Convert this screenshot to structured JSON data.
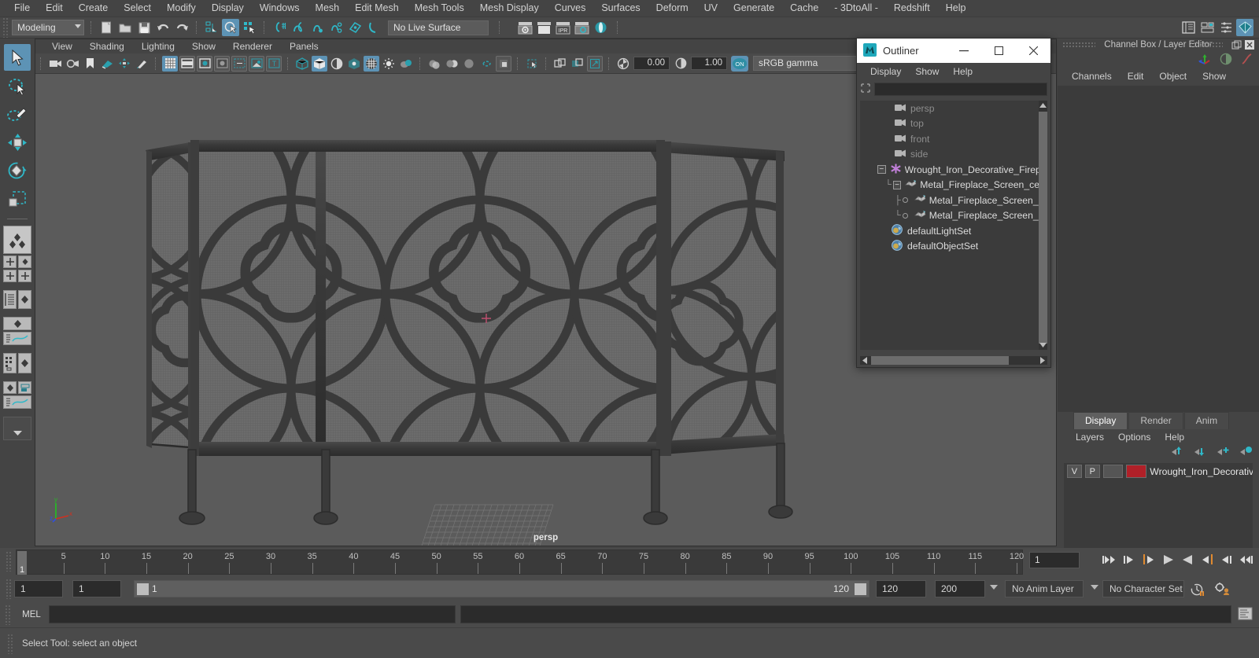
{
  "menubar": {
    "items": [
      "File",
      "Edit",
      "Create",
      "Select",
      "Modify",
      "Display",
      "Windows",
      "Mesh",
      "Edit Mesh",
      "Mesh Tools",
      "Mesh Display",
      "Curves",
      "Surfaces",
      "Deform",
      "UV",
      "Generate",
      "Cache",
      "- 3DtoAll -",
      "Redshift",
      "Help"
    ]
  },
  "statusbar": {
    "menuset": "Modeling",
    "live_surface": "No Live Surface",
    "icons": [
      "new-scene-icon",
      "open-scene-icon",
      "save-scene-icon",
      "undo-icon",
      "redo-icon",
      "select-by-hierarchy-icon",
      "select-by-object-icon",
      "select-by-component-icon",
      "snap-to-grid-icon",
      "snap-to-curve-icon",
      "snap-to-point-icon",
      "snap-to-projected-center-icon",
      "snap-to-view-plane-icon",
      "make-live-icon",
      "render-current-frame-icon",
      "ipr-render-icon",
      "render-settings-icon",
      "hypershade-icon",
      "toggle-sidebar-icon",
      "attribute-editor-icon",
      "tool-settings-icon",
      "channel-box-icon"
    ]
  },
  "toolbox": {
    "tools": [
      "select-tool",
      "lasso-select-tool",
      "paint-select-tool",
      "move-tool",
      "rotate-tool",
      "scale-tool"
    ],
    "selected": "select-tool",
    "layout_icons": [
      "single-perspective-view",
      "four-view",
      "outliner-persp",
      "persp-graph",
      "hypergraph-persp",
      "persp-graph-2",
      "outliner-list",
      "persp-outliner",
      "graph-editor"
    ]
  },
  "viewport": {
    "menu": [
      "View",
      "Shading",
      "Lighting",
      "Show",
      "Renderer",
      "Panels"
    ],
    "camera_label": "persp",
    "exposure": "0.00",
    "gamma": "1.00",
    "color_space": "sRGB gamma",
    "gamma_toggle": "ON",
    "axis": {
      "x": "x",
      "y": "y",
      "z": "z"
    },
    "icons": [
      "select-camera-icon",
      "camera-attributes-icon",
      "bookmark-icon",
      "image-plane-icon",
      "2d-pan-zoom-icon",
      "grease-pencil-icon",
      "grid-icon",
      "film-gate-icon",
      "resolution-gate-icon",
      "gate-mask-icon",
      "field-chart-icon",
      "safe-action-icon",
      "safe-title-icon",
      "wireframe-icon",
      "smooth-shade-icon",
      "shaded-wireframe-icon",
      "use-default-material-icon",
      "textured-icon",
      "use-all-lights-icon",
      "shadows-icon",
      "screen-space-ao-icon",
      "motion-blur-icon",
      "multisample-icon",
      "depth-of-field-icon",
      "isolate-select-icon",
      "xray-icon",
      "xray-joints-icon",
      "xray-active-components-icon",
      "exposure-icon",
      "gamma-icon"
    ]
  },
  "outliner": {
    "title": "Outliner",
    "window_buttons": [
      "minimize-button",
      "maximize-button",
      "close-button"
    ],
    "menu": [
      "Display",
      "Show",
      "Help"
    ],
    "search_value": "",
    "tree": [
      {
        "label": "persp",
        "icon": "camera-icon",
        "depth": 1,
        "style": "dim",
        "expander": "none"
      },
      {
        "label": "top",
        "icon": "camera-icon",
        "depth": 1,
        "style": "dim",
        "expander": "none"
      },
      {
        "label": "front",
        "icon": "camera-icon",
        "depth": 1,
        "style": "dim",
        "expander": "none"
      },
      {
        "label": "side",
        "icon": "camera-icon",
        "depth": 1,
        "style": "dim",
        "expander": "none"
      },
      {
        "label": "Wrought_Iron_Decorative_Fireplac",
        "icon": "group-icon",
        "depth": 0,
        "style": "bright",
        "expander": "minus"
      },
      {
        "label": "Metal_Fireplace_Screen_centra",
        "icon": "mesh-icon",
        "depth": 1,
        "style": "bright",
        "expander": "minus"
      },
      {
        "label": "Metal_Fireplace_Screen_rig",
        "icon": "mesh-icon",
        "depth": 2,
        "style": "bright",
        "expander": "leaf"
      },
      {
        "label": "Metal_Fireplace_Screen_lef",
        "icon": "mesh-icon",
        "depth": 2,
        "style": "bright",
        "expander": "leaf"
      },
      {
        "label": "defaultLightSet",
        "icon": "set-icon",
        "depth": 1,
        "style": "bright",
        "expander": "none"
      },
      {
        "label": "defaultObjectSet",
        "icon": "set-icon",
        "depth": 1,
        "style": "bright",
        "expander": "none"
      }
    ]
  },
  "right_panel": {
    "title": "Channel Box / Layer Editor",
    "channelbox_menu": [
      "Channels",
      "Edit",
      "Object",
      "Show"
    ],
    "layer_tabs": [
      "Display",
      "Render",
      "Anim"
    ],
    "layer_tab_selected": "Display",
    "layer_menu": [
      "Layers",
      "Options",
      "Help"
    ],
    "layer_icons": [
      "move-layer-up-icon",
      "move-layer-down-icon",
      "new-layer-icon",
      "new-layer-from-selected-icon"
    ],
    "layers": [
      {
        "visibility": "V",
        "playback": "P",
        "color": "#b02028",
        "name": "Wrought_Iron_Decorativ"
      }
    ]
  },
  "timeline": {
    "current_frame": "1",
    "frame_field": "1",
    "ticks": [
      5,
      10,
      15,
      20,
      25,
      30,
      35,
      40,
      45,
      50,
      55,
      60,
      65,
      70,
      75,
      80,
      85,
      90,
      95,
      100,
      105,
      110,
      115,
      120
    ],
    "playback_buttons": [
      "go-to-start-icon",
      "step-back-keyframe-icon",
      "step-back-frame-icon",
      "play-backwards-icon",
      "play-forwards-icon",
      "step-forward-frame-icon",
      "step-forward-keyframe-icon",
      "go-to-end-icon"
    ]
  },
  "range": {
    "anim_start": "1",
    "range_start": "1",
    "slider_min": "1",
    "slider_max": "120",
    "range_end": "120",
    "anim_end": "200",
    "anim_layer": "No Anim Layer",
    "character_set": "No Character Set",
    "icons": [
      "auto-keyframe-icon",
      "animation-preferences-icon"
    ]
  },
  "command_line": {
    "language": "MEL",
    "command_value": "",
    "result_value": "",
    "script_editor_icon": "script-editor-icon"
  },
  "status": {
    "message": "Select Tool: select an object"
  }
}
